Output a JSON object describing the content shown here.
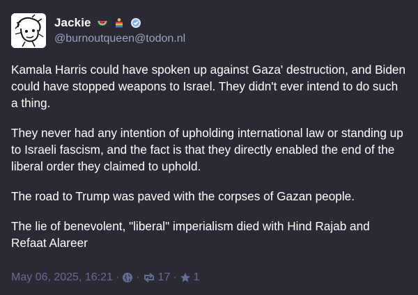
{
  "author": {
    "display_name": "Jackie",
    "handle": "@burnoutqueen@todon.nl",
    "avatar_icon": "hand-drawn-avatar-icon",
    "emoji_icons": [
      "watermelon-icon",
      "rainbow-people-icon",
      "badge-icon"
    ]
  },
  "post": {
    "paragraphs": [
      "Kamala Harris could have spoken up against Gaza' destruction, and Biden could have stopped weapons to Israel. They didn't ever intend to do such a thing.",
      "They never had any intention of upholding international law or standing up to Israeli fascism, and the fact is that they directly enabled the end of the liberal order they claimed to uphold.",
      "The road to Trump was paved with the corpses of Gazan people.",
      "The lie of benevolent, \"liberal\" imperialism died with Hind Rajab and Refaat Alareer"
    ]
  },
  "footer": {
    "timestamp": "May 06, 2025, 16:21",
    "separator": "·",
    "visibility_icon": "globe-icon",
    "boost_icon": "boost-icon",
    "boost_count": "17",
    "favourite_icon": "star-icon",
    "favourite_count": "1"
  },
  "colors": {
    "background": "#292a34",
    "text": "#ffffff",
    "muted": "#656d93",
    "handle": "#a0a3c0"
  }
}
